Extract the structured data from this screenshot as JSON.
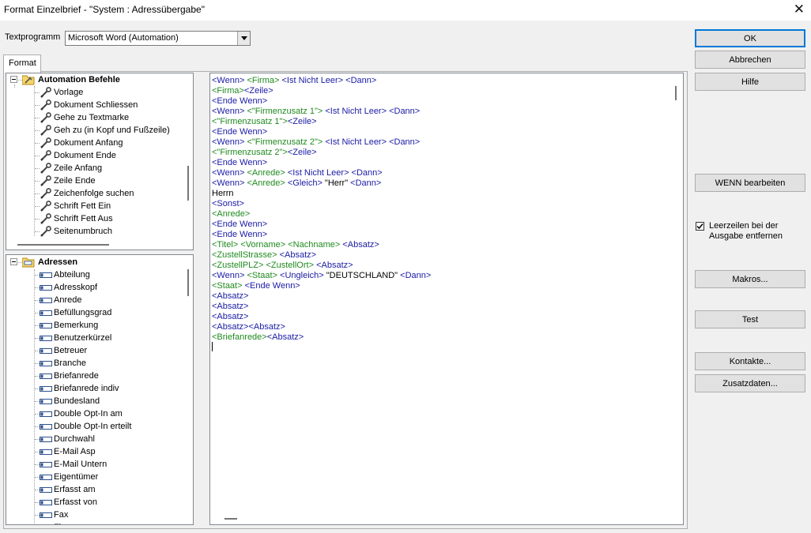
{
  "window": {
    "title": "Format Einzelbrief - \"System : Adressübergabe\""
  },
  "textprogramm": {
    "label": "Textprogramm",
    "value": "Microsoft Word (Automation)"
  },
  "tabs": [
    {
      "label": "Format"
    }
  ],
  "commands_tree": {
    "root": "Automation Befehle",
    "items": [
      "Vorlage",
      "Dokument Schliessen",
      "Gehe zu Textmarke",
      "Geh zu (in Kopf und Fußzeile)",
      "Dokument Anfang",
      "Dokument Ende",
      "Zeile Anfang",
      "Zeile Ende",
      "Zeichenfolge suchen",
      "Schrift Fett Ein",
      "Schrift Fett Aus",
      "Seitenumbruch"
    ]
  },
  "fields_tree": {
    "root": "Adressen",
    "items": [
      "Abteilung",
      "Adresskopf",
      "Anrede",
      "Befüllungsgrad",
      "Bemerkung",
      "Benutzerkürzel",
      "Betreuer",
      "Branche",
      "Briefanrede",
      "Briefanrede indiv",
      "Bundesland",
      "Double Opt-In am",
      "Double Opt-In erteilt",
      "Durchwahl",
      "E-Mail Asp",
      "E-Mail Untern",
      "Eigentümer",
      "Erfasst am",
      "Erfasst von",
      "Fax",
      "Fi..."
    ]
  },
  "editor": {
    "lines": [
      [
        [
          "blue",
          "<Wenn> "
        ],
        [
          "green",
          "<Firma>"
        ],
        [
          "blue",
          " <Ist Nicht Leer> <Dann>"
        ]
      ],
      [
        [
          "green",
          "<Firma>"
        ],
        [
          "blue",
          "<Zeile>"
        ]
      ],
      [
        [
          "blue",
          "<Ende Wenn>"
        ]
      ],
      [
        [
          "blue",
          "<Wenn> "
        ],
        [
          "green",
          "<\"Firmenzusatz 1\">"
        ],
        [
          "blue",
          " <Ist Nicht Leer> <Dann>"
        ]
      ],
      [
        [
          "green",
          "<\"Firmenzusatz 1\">"
        ],
        [
          "blue",
          "<Zeile>"
        ]
      ],
      [
        [
          "blue",
          "<Ende Wenn>"
        ]
      ],
      [
        [
          "blue",
          "<Wenn> "
        ],
        [
          "green",
          "<\"Firmenzusatz 2\">"
        ],
        [
          "blue",
          " <Ist Nicht Leer> <Dann>"
        ]
      ],
      [
        [
          "green",
          "<\"Firmenzusatz 2\">"
        ],
        [
          "blue",
          "<Zeile>"
        ]
      ],
      [
        [
          "blue",
          "<Ende Wenn>"
        ]
      ],
      [
        [
          "blue",
          "<Wenn> "
        ],
        [
          "green",
          "<Anrede>"
        ],
        [
          "blue",
          " <Ist Nicht Leer> <Dann>"
        ]
      ],
      [
        [
          "blue",
          "<Wenn> "
        ],
        [
          "green",
          "<Anrede>"
        ],
        [
          "blue",
          " <Gleich> "
        ],
        [
          "black",
          "\"Herr\""
        ],
        [
          "blue",
          " <Dann>"
        ]
      ],
      [
        [
          "black",
          "Herrn"
        ]
      ],
      [
        [
          "blue",
          "<Sonst>"
        ]
      ],
      [
        [
          "green",
          "<Anrede>"
        ]
      ],
      [
        [
          "blue",
          "<Ende Wenn>"
        ]
      ],
      [
        [
          "blue",
          "<Ende Wenn>"
        ]
      ],
      [
        [
          "green",
          "<Titel>"
        ],
        [
          "blue",
          " "
        ],
        [
          "green",
          "<Vorname>"
        ],
        [
          "blue",
          " "
        ],
        [
          "green",
          "<Nachname>"
        ],
        [
          "blue",
          " <Absatz>"
        ]
      ],
      [
        [
          "green",
          "<ZustellStrasse>"
        ],
        [
          "blue",
          " <Absatz>"
        ]
      ],
      [
        [
          "green",
          "<ZustellPLZ>"
        ],
        [
          "blue",
          " "
        ],
        [
          "green",
          "<ZustellOrt>"
        ],
        [
          "blue",
          " <Absatz>"
        ]
      ],
      [
        [
          "blue",
          "<Wenn> "
        ],
        [
          "green",
          "<Staat>"
        ],
        [
          "blue",
          " <Ungleich> "
        ],
        [
          "black",
          "\"DEUTSCHLAND\""
        ],
        [
          "blue",
          " <Dann>"
        ]
      ],
      [
        [
          "green",
          "<Staat>"
        ],
        [
          "blue",
          " <Ende Wenn>"
        ]
      ],
      [
        [
          "blue",
          "<Absatz>"
        ]
      ],
      [
        [
          "blue",
          "<Absatz>"
        ]
      ],
      [
        [
          "blue",
          "<Absatz>"
        ]
      ],
      [
        [
          "blue",
          "<Absatz><Absatz>"
        ]
      ],
      [
        [
          "green",
          "<Briefanrede>"
        ],
        [
          "blue",
          "<Absatz>"
        ]
      ]
    ]
  },
  "buttons": {
    "ok": "OK",
    "cancel": "Abbrechen",
    "help": "Hilfe",
    "wenn": "WENN bearbeiten",
    "makros": "Makros...",
    "test": "Test",
    "kontakte": "Kontakte...",
    "zusatzdaten": "Zusatzdaten..."
  },
  "checkbox": {
    "label": "Leerzeilen bei der Ausgabe entfernen",
    "checked": true
  },
  "colors": {
    "blue": "#1a1aa6",
    "green": "#1f8a1f",
    "accent": "#0078d7"
  },
  "icons": {
    "commands_item": "wrench-icon",
    "commands_root": "folder-wrench-icon",
    "fields_item": "field-icon",
    "fields_root": "folder-fields-icon",
    "close": "close-icon",
    "dropdown": "chevron-down-icon"
  }
}
